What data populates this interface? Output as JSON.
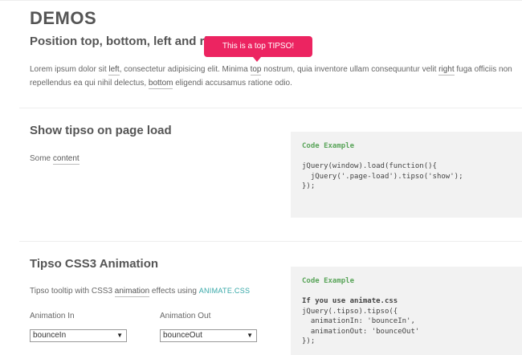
{
  "header": {
    "title": "DEMOS"
  },
  "section1": {
    "title": "Position top, bottom, left and righ",
    "tooltip": "This is a top TIPSO!",
    "p1": "Lorem ipsum dolor sit ",
    "l1": "left",
    "p2": ", consectetur adipisicing elit. Minima ",
    "l2": "top",
    "p3": " nostrum, quia inventore ullam consequuntur velit ",
    "l3": "right",
    "p4": " fuga officiis non repellendus ea qui nihil delectus, ",
    "l4": "bottom",
    "p5": " eligendi accusamus ratione odio."
  },
  "section2": {
    "title": "Show tipso on page load",
    "text_prefix": "Some ",
    "text_link": "content",
    "code_title": "Code Example",
    "code": "jQuery(window).load(function(){\n  jQuery('.page-load').tipso('show');\n});"
  },
  "section3": {
    "title": "Tipso CSS3 Animation",
    "text_prefix": "Tipso tooltip with CSS3 ",
    "text_link": "animation",
    "text_mid": " effects using ",
    "lib_link": "ANIMATE.CSS",
    "anim_in_label": "Animation In",
    "anim_in_value": "bounceIn",
    "anim_out_label": "Animation Out",
    "anim_out_value": "bounceOut",
    "code_title": "Code Example",
    "code_first_line": "If you use animate.css",
    "code": "jQuery(.tipso).tipso({\n  animationIn: 'bounceIn',\n  animationOut: 'bounceOut'\n});"
  },
  "icons": {
    "select_arrow": "▼"
  },
  "colors": {
    "tooltip_bg": "#ec2461",
    "code_title": "#5aa55a",
    "link_accent": "#35a7a7"
  }
}
